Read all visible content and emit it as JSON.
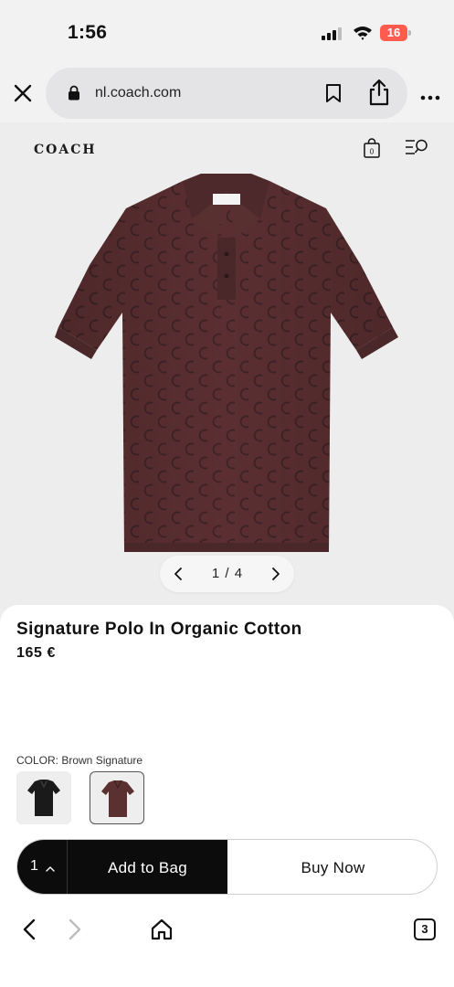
{
  "status_bar": {
    "time": "1:56",
    "battery": "16"
  },
  "browser": {
    "url": "nl.coach.com"
  },
  "site": {
    "logo": "COACH"
  },
  "gallery": {
    "counter": "1 / 4",
    "current": 1,
    "total": 4
  },
  "product": {
    "title": "Signature Polo In Organic Cotton",
    "price": "165 €",
    "color_label": "COLOR: Brown Signature",
    "swatches": [
      {
        "name": "Black",
        "color": "#1a1a1a",
        "selected": false
      },
      {
        "name": "Brown Signature",
        "color": "#5b3030",
        "selected": true
      }
    ]
  },
  "cart": {
    "quantity": "1",
    "add_label": "Add to Bag",
    "buy_label": "Buy Now"
  },
  "toolbar": {
    "tab_count": "3"
  },
  "colors": {
    "polo": "#5b2f31",
    "polo_pattern": "#3e2226",
    "accent": "#0c0c0c"
  }
}
